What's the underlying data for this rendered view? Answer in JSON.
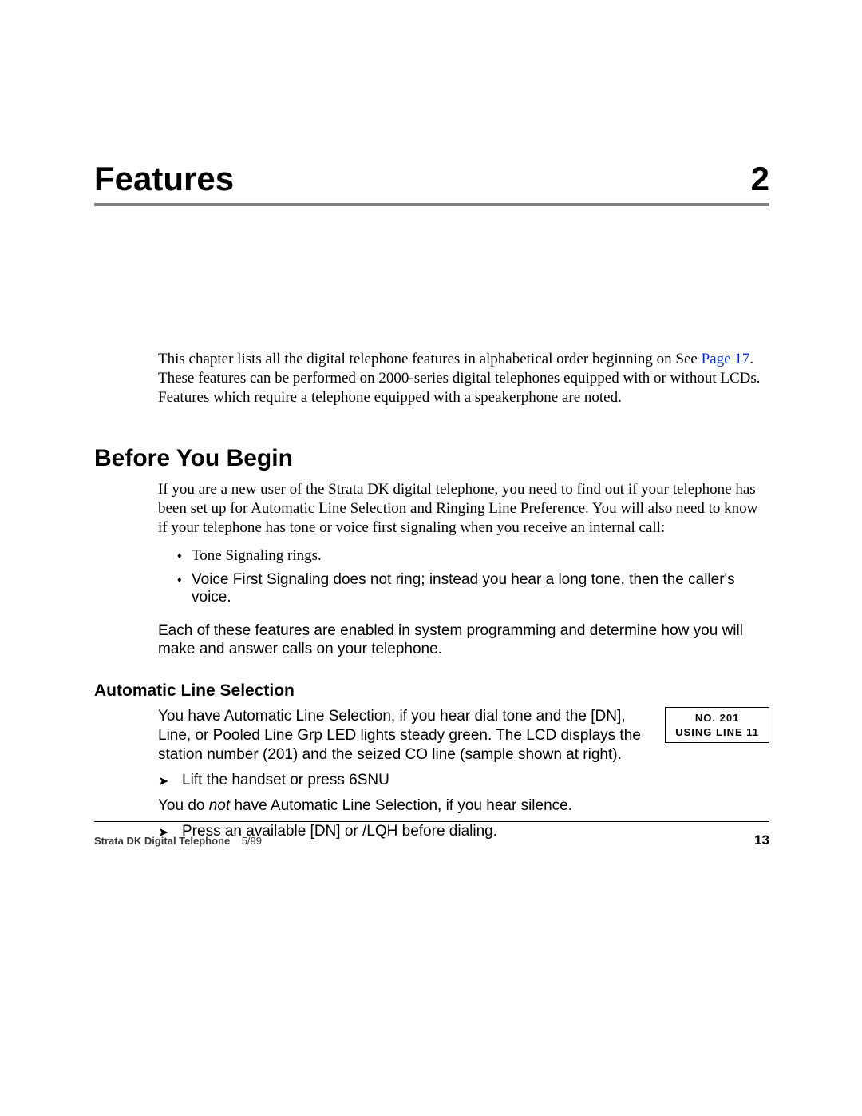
{
  "chapter": {
    "title": "Features",
    "number": "2"
  },
  "intro": {
    "lead": "This chapter lists all the digital telephone features in alphabetical order beginning on See ",
    "link_text": "Page 17",
    "trail": ". These features can be performed on 2000-series digital telephones equipped with or without LCDs. Features which require a telephone equipped with a speakerphone are noted."
  },
  "before_you_begin": {
    "heading": "Before You Begin",
    "para1": "If you are a new user of the Strata DK digital telephone, you need to find out if your telephone has been set up for Automatic Line Selection and Ringing Line Preference. You will also need to know if your telephone has tone or voice first signaling when you receive an internal call:",
    "bullets": [
      "Tone Signaling rings.",
      "Voice First Signaling does not ring; instead you hear a long tone, then the caller's voice."
    ],
    "para2": "Each of these features are enabled in system programming and determine how you will make and answer calls on your telephone."
  },
  "auto_line": {
    "heading": "Automatic Line Selection",
    "lcd": {
      "line1": "NO. 201",
      "line2": "USING LINE 11"
    },
    "para1_a": "You have ",
    "para1_b": "Automatic Line Selection, if you hear dial tone and the [DN], Line, or Pooled Line Grp LED lights steady green. The LCD displays the station number (",
    "para1_c": "201",
    "para1_d": ") and the seized CO line (sample shown at right).",
    "arrow1_a": "Lift the handset or press ",
    "arrow1_b": "6SNU",
    "para2_a": "You do ",
    "para2_b": "not",
    "para2_c": " have Automatic Line Selection, if you hear silence.",
    "arrow2_a": "Press an available [DN] or ",
    "arrow2_b": "/LQH",
    "arrow2_c": " before dialing."
  },
  "footer": {
    "title": "Strata DK Digital Telephone",
    "date": "5/99",
    "page": "13"
  }
}
